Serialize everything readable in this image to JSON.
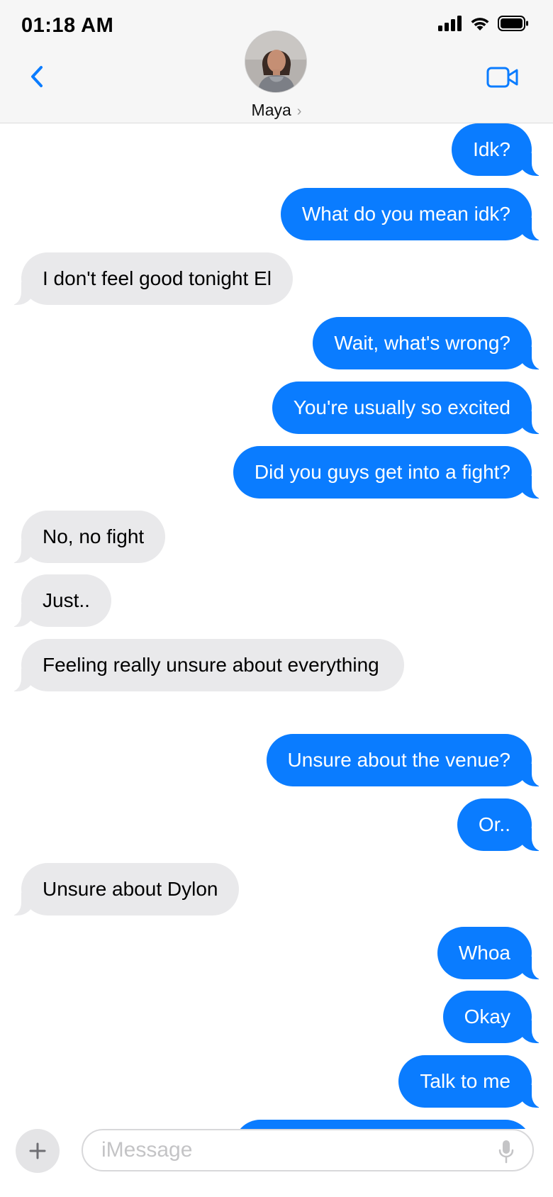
{
  "status_bar": {
    "time": "01:18 AM"
  },
  "header": {
    "contact_name": "Maya",
    "chevron": "›"
  },
  "messages": [
    {
      "side": "out",
      "text": "Idk?"
    },
    {
      "side": "out",
      "text": "What do you mean idk?"
    },
    {
      "side": "in",
      "text": "I don't feel good tonight El"
    },
    {
      "side": "out",
      "text": "Wait, what's wrong?"
    },
    {
      "side": "out",
      "text": "You're usually so excited"
    },
    {
      "side": "out",
      "text": "Did you guys get into a fight?"
    },
    {
      "side": "in",
      "text": "No, no fight"
    },
    {
      "side": "in",
      "text": "Just.."
    },
    {
      "side": "in",
      "text": "Feeling really unsure about everything"
    },
    {
      "side": "out",
      "text": "Unsure about the venue?"
    },
    {
      "side": "out",
      "text": "Or.."
    },
    {
      "side": "in",
      "text": "Unsure about Dylon"
    },
    {
      "side": "out",
      "text": "Whoa"
    },
    {
      "side": "out",
      "text": "Okay"
    },
    {
      "side": "out",
      "text": "Talk to me"
    },
    {
      "side": "out",
      "text": ""
    }
  ],
  "composer": {
    "placeholder": "iMessage"
  },
  "icons": {
    "back": "chevron-left-icon",
    "video": "video-camera-icon",
    "signal": "cellular-signal-icon",
    "wifi": "wifi-icon",
    "battery": "battery-icon",
    "add": "plus-icon",
    "mic": "microphone-icon"
  },
  "colors": {
    "outgoing_bubble": "#0a7cff",
    "incoming_bubble": "#e9e9eb",
    "accent": "#0a7cff"
  }
}
